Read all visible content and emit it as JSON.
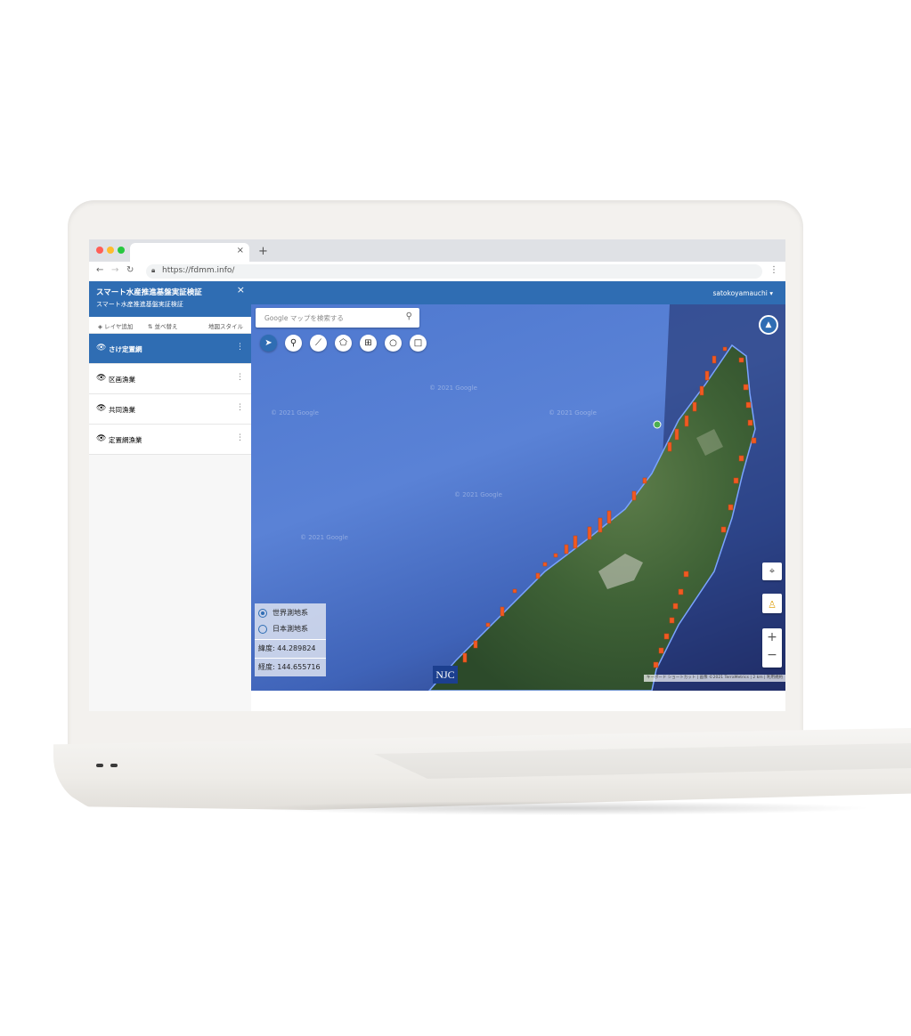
{
  "browser": {
    "url": "https://fdmm.info/",
    "tab_close": "×",
    "new_tab": "+"
  },
  "sidebar": {
    "title": "スマート水産推進基盤実証検証",
    "subtitle": "スマート水産推進基盤実証検証",
    "close": "×",
    "tools": {
      "add_layer": "レイヤ追加",
      "reorder": "並べ替え",
      "map_style": "地図スタイル"
    },
    "layers": [
      {
        "label": "さけ定置網",
        "active": true
      },
      {
        "label": "区画漁業",
        "active": false
      },
      {
        "label": "共同漁業",
        "active": false
      },
      {
        "label": "定置網漁業",
        "active": false
      }
    ]
  },
  "header": {
    "user": "satokoyamauchi"
  },
  "map": {
    "search_placeholder": "Google マップを検索する",
    "watermark": "© 2021 Google",
    "datum": {
      "world": "世界測地系",
      "japan": "日本測地系",
      "selected": "world"
    },
    "latitude": "緯度: 44.289824",
    "longitude": "経度: 144.655716",
    "logo": "NJC",
    "attribution": "キーボード ショートカット | 画像 ©2021 TerraMetrics | 2 km | 利用規約",
    "zoom_in": "+",
    "zoom_out": "−"
  },
  "colors": {
    "brand": "#2f6db3",
    "marker": "#f05a24",
    "point": "#4caf50"
  }
}
